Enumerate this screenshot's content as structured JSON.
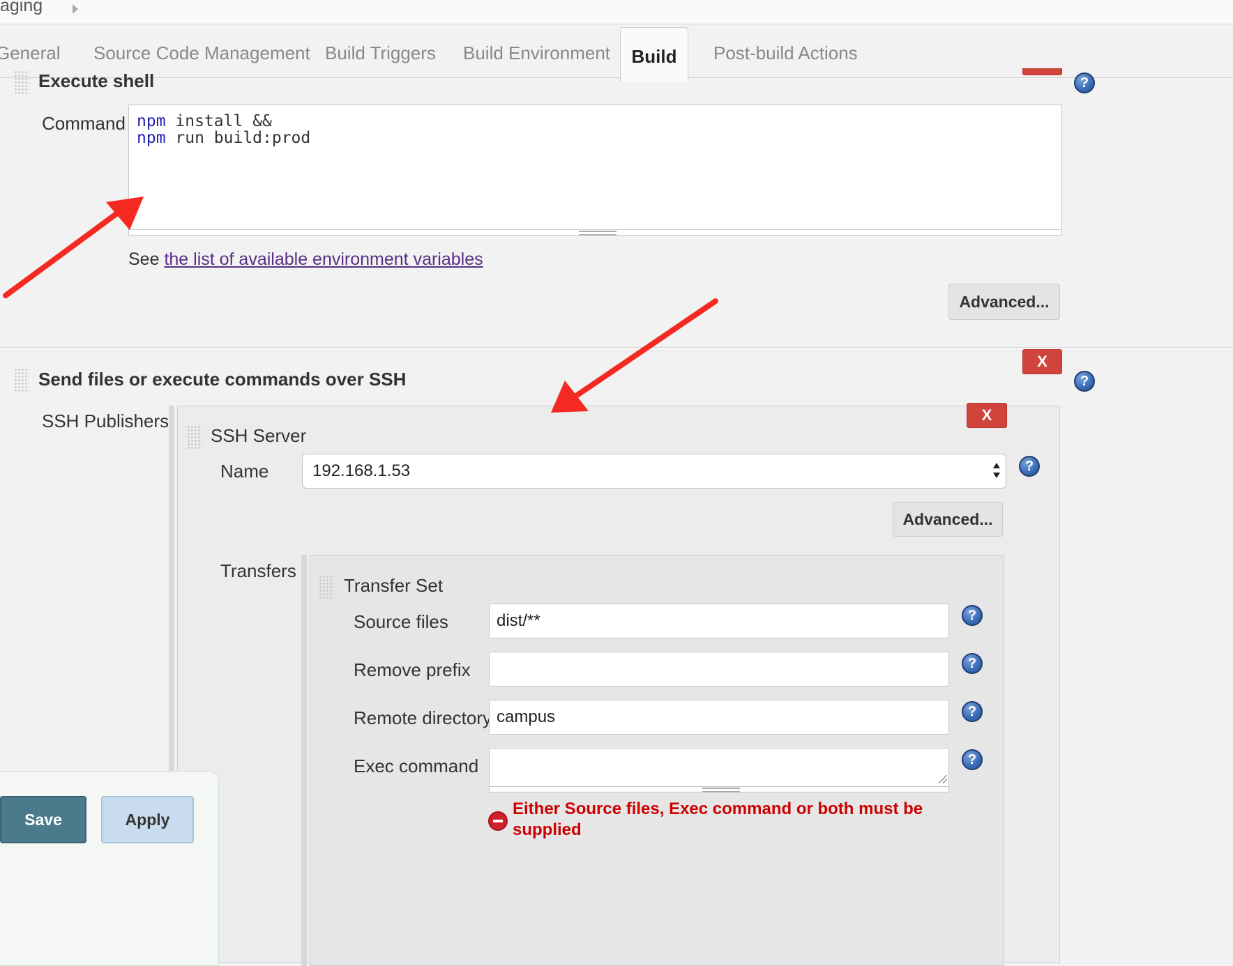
{
  "breadcrumb": {
    "text": "aging"
  },
  "tabs": [
    {
      "label": "General"
    },
    {
      "label": "Source Code Management"
    },
    {
      "label": "Build Triggers"
    },
    {
      "label": "Build Environment"
    },
    {
      "label": "Build"
    },
    {
      "label": "Post-build Actions"
    }
  ],
  "active_tab": "Build",
  "execute_shell": {
    "title": "Execute shell",
    "command_label": "Command",
    "command_lines": [
      {
        "cmd": "npm",
        "args": " install &&"
      },
      {
        "cmd": "npm",
        "args": " run build:prod"
      }
    ],
    "see_text": "See",
    "env_link": "the list of available environment variables",
    "advanced_label": "Advanced..."
  },
  "ssh": {
    "title": "Send files or execute commands over SSH",
    "delete_label": "X",
    "publishers_label": "SSH Publishers",
    "server": {
      "title": "SSH Server",
      "delete_label": "X",
      "name_label": "Name",
      "name_value": "192.168.1.53",
      "advanced_label": "Advanced..."
    },
    "transfers_label": "Transfers",
    "transfer_set": {
      "title": "Transfer Set",
      "source_files_label": "Source files",
      "source_files_value": "dist/**",
      "remove_prefix_label": "Remove prefix",
      "remove_prefix_value": "",
      "remote_directory_label": "Remote directory",
      "remote_directory_value": "campus",
      "exec_command_label": "Exec command",
      "exec_command_value": "",
      "error_message": "Either Source files, Exec command or both must be supplied"
    }
  },
  "help_icon_glyph": "?",
  "footer": {
    "save_label": "Save",
    "apply_label": "Apply"
  },
  "colors": {
    "arrow": "#f42a22",
    "delete": "#d0443c",
    "error": "#cc0000",
    "save": "#4a7a8c",
    "apply": "#c9dbee"
  }
}
